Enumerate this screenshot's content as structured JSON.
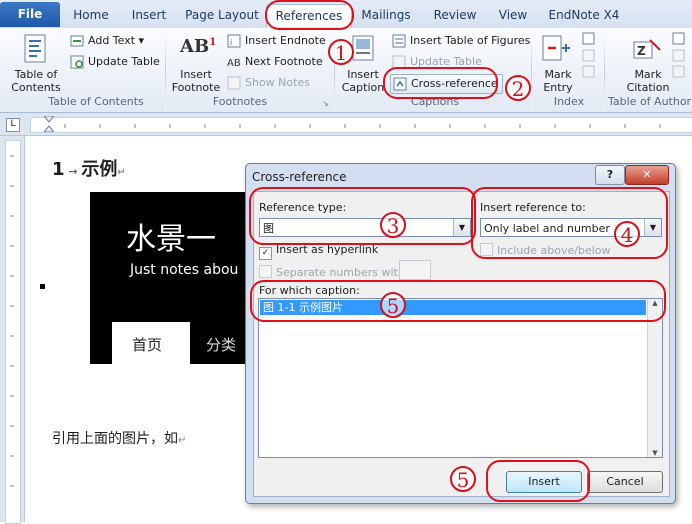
{
  "tabs": {
    "file": "File",
    "home": "Home",
    "insert": "Insert",
    "page_layout": "Page Layout",
    "references": "References",
    "mailings": "Mailings",
    "review": "Review",
    "view": "View",
    "endnote": "EndNote X4"
  },
  "ribbon": {
    "toc": {
      "big_button": "Table of Contents",
      "add_text": "Add Text",
      "update_table": "Update Table",
      "group": "Table of Contents"
    },
    "footnotes": {
      "insert_footnote": "Insert Footnote",
      "insert_endnote": "Insert Endnote",
      "next_footnote": "Next Footnote",
      "show_notes": "Show Notes",
      "group": "Footnotes"
    },
    "captions": {
      "insert_caption": "Insert Caption",
      "insert_table_of_figures": "Insert Table of Figures",
      "update_table": "Update Table",
      "cross_reference": "Cross-reference",
      "group": "Captions"
    },
    "index": {
      "mark_entry": "Mark Entry",
      "group": "Index"
    },
    "authorities": {
      "mark_citation": "Mark Citation",
      "group": "Table of Authori"
    }
  },
  "document": {
    "heading_number": "1",
    "heading_text": "示例",
    "image_title": "水景一",
    "image_subtitle": "Just notes abou",
    "image_tab_home": "首页",
    "image_tab_category": "分类",
    "body_text": "引用上面的图片，如"
  },
  "dialog": {
    "title": "Cross-reference",
    "help": "?",
    "close": "✕",
    "reference_type_label": "Reference type:",
    "reference_type_value": "图",
    "insert_reference_to_label": "Insert reference to:",
    "insert_reference_to_value": "Only label and number",
    "insert_as_hyperlink": "Insert as hyperlink",
    "include_above_below": "Include above/below",
    "separate_numbers_with": "Separate numbers with",
    "for_which_caption_label": "For which caption:",
    "caption_items": [
      "图 1-1 示例图片"
    ],
    "insert_button": "Insert",
    "cancel_button": "Cancel"
  },
  "annotations": [
    "1",
    "2",
    "3",
    "4",
    "5",
    "5",
    "5"
  ],
  "colors": {
    "annotation_red": "#e0101a",
    "selection_blue": "#3399ff"
  }
}
